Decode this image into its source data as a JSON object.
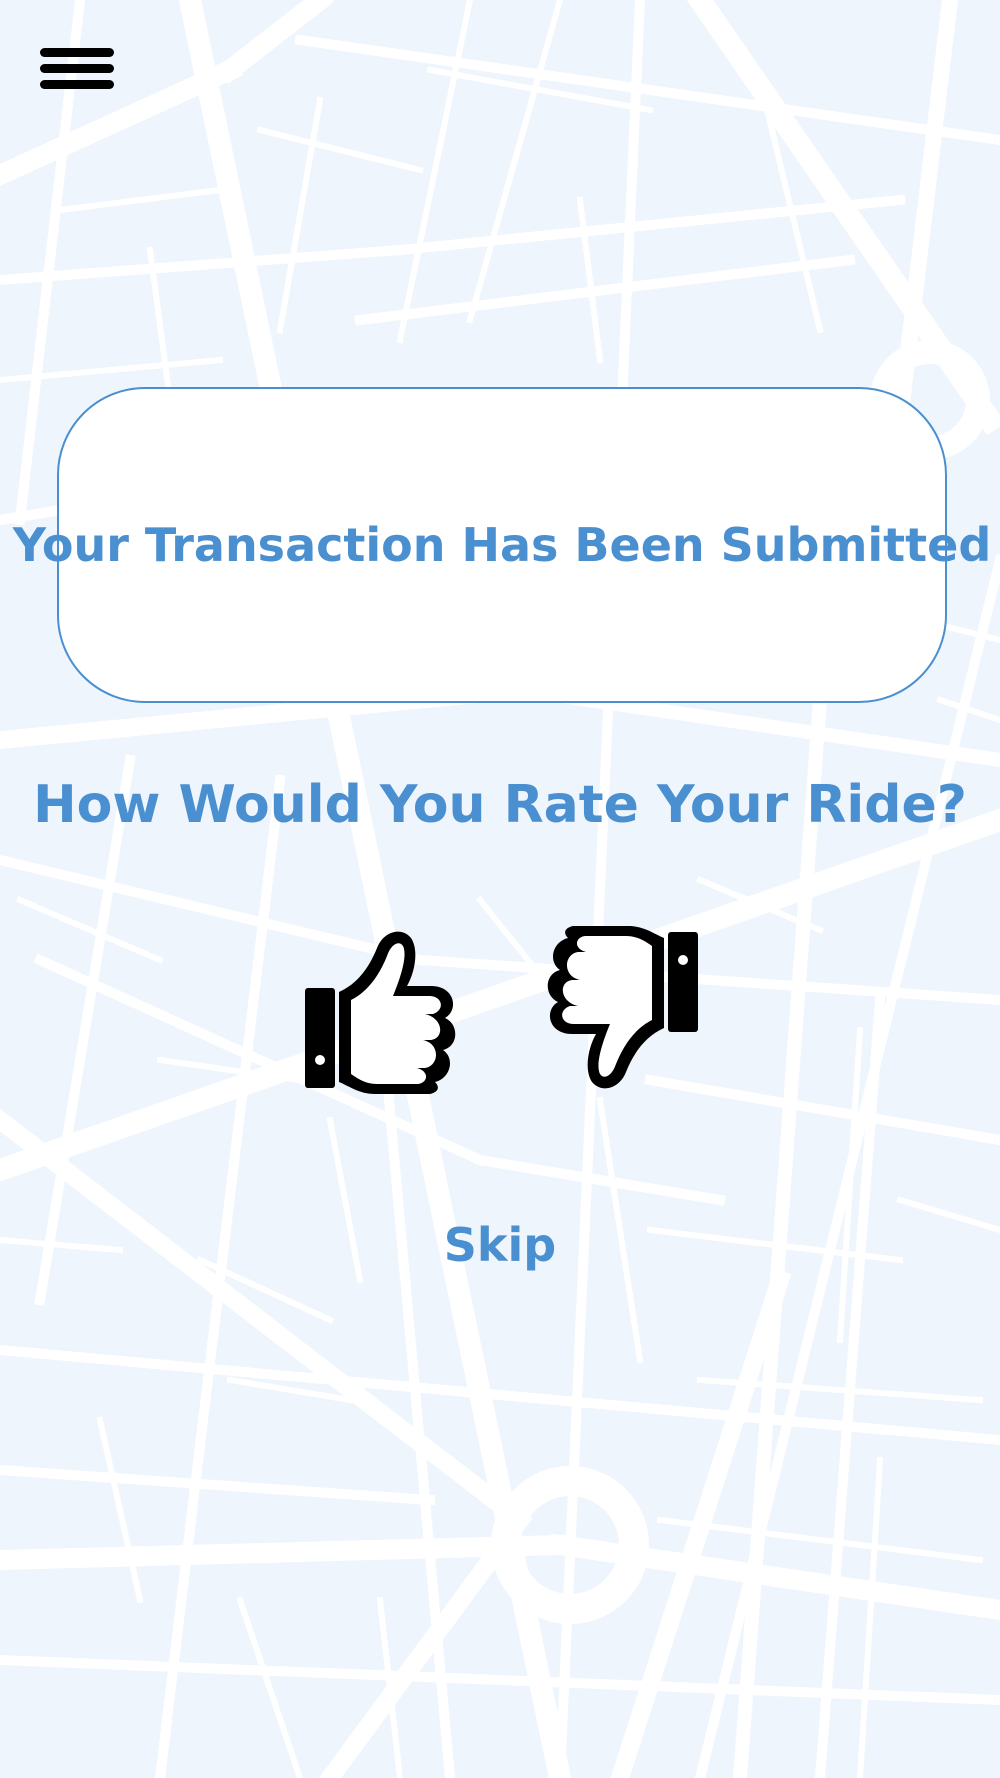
{
  "app": {
    "menu_icon": "hamburger-menu-icon",
    "accent_color": "#4a8fd0",
    "background_color": "#eef5fc"
  },
  "banner": {
    "message": "Your Transaction Has Been Submitted"
  },
  "rating": {
    "prompt": "How Would You Rate Your Ride?",
    "thumbs_up_icon": "thumbs-up-icon",
    "thumbs_down_icon": "thumbs-down-icon"
  },
  "actions": {
    "skip_label": "Skip"
  }
}
